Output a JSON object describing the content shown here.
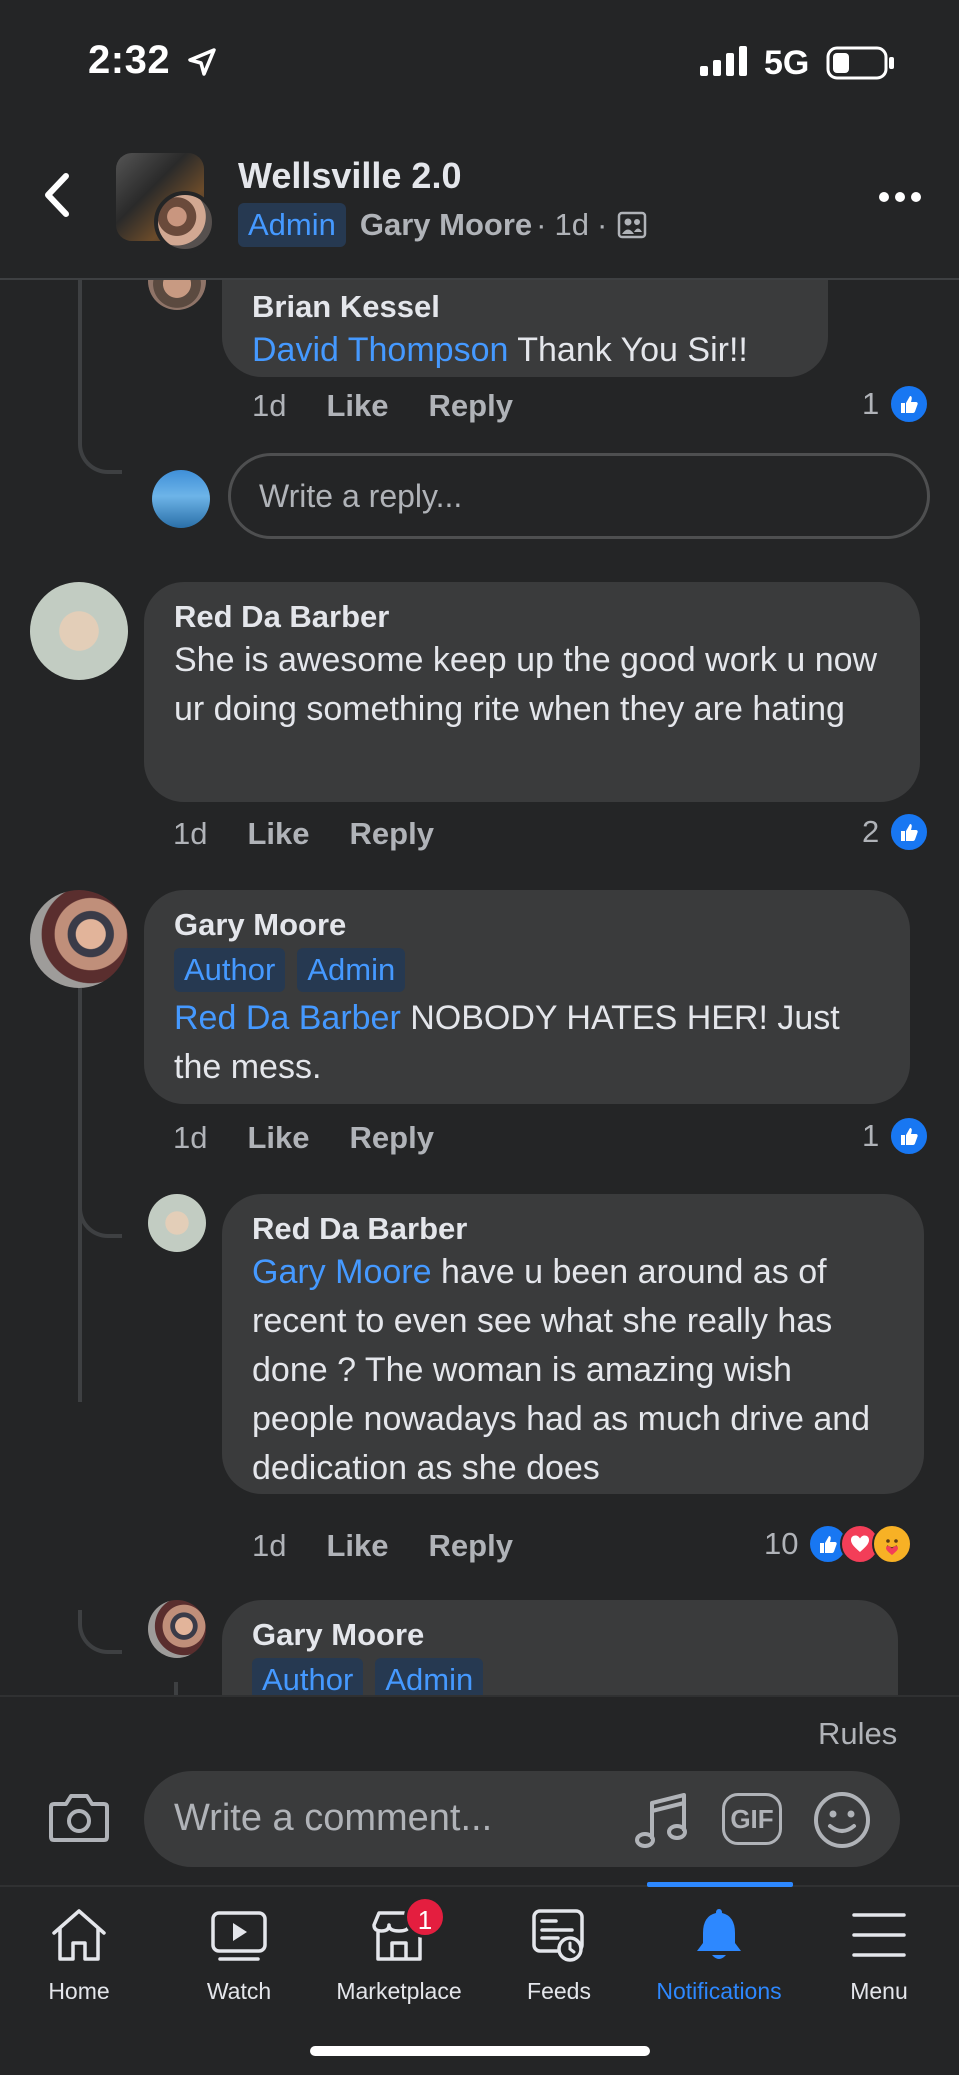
{
  "status": {
    "time": "2:32",
    "network": "5G"
  },
  "header": {
    "group_name": "Wellsville 2.0",
    "badge": "Admin",
    "poster": "Gary Moore",
    "dot1": "·",
    "age": "1d",
    "dot2": "·"
  },
  "comments": [
    {
      "name": "Brian Kessel",
      "mention": "David Thompson",
      "text": "Thank You Sir!!",
      "time": "1d",
      "like": "Like",
      "reply": "Reply",
      "reaction_count": "1"
    },
    {
      "reply_placeholder": "Write a reply..."
    },
    {
      "name": "Red Da Barber",
      "text": "She is awesome keep up the good work u now ur doing something rite when they are hating",
      "time": "1d",
      "like": "Like",
      "reply": "Reply",
      "reaction_count": "2"
    },
    {
      "name": "Gary Moore",
      "badges": [
        "Author",
        "Admin"
      ],
      "mention": "Red Da Barber",
      "text": "NOBODY HATES HER! Just the mess.",
      "time": "1d",
      "like": "Like",
      "reply": "Reply",
      "reaction_count": "1"
    },
    {
      "name": "Red Da Barber",
      "mention": "Gary Moore",
      "text": "have u been around as of recent to even see what she really has done ? The woman is amazing wish people nowadays had as much drive and dedication as she does",
      "time": "1d",
      "like": "Like",
      "reply": "Reply",
      "reaction_count": "10"
    },
    {
      "name": "Gary Moore",
      "badges": [
        "Author",
        "Admin"
      ]
    }
  ],
  "composer": {
    "rules": "Rules",
    "placeholder": "Write a comment...",
    "gif": "GIF"
  },
  "tabs": [
    {
      "label": "Home",
      "icon": "home-icon"
    },
    {
      "label": "Watch",
      "icon": "watch-icon"
    },
    {
      "label": "Marketplace",
      "icon": "marketplace-icon",
      "badge": "1"
    },
    {
      "label": "Feeds",
      "icon": "feeds-icon"
    },
    {
      "label": "Notifications",
      "icon": "bell-icon",
      "active": true
    },
    {
      "label": "Menu",
      "icon": "menu-icon"
    }
  ],
  "colors": {
    "background": "#242526",
    "bubble": "#3a3b3c",
    "accent": "#4599ff",
    "like_blue": "#1877f2",
    "badge_red": "#e41e3f"
  }
}
